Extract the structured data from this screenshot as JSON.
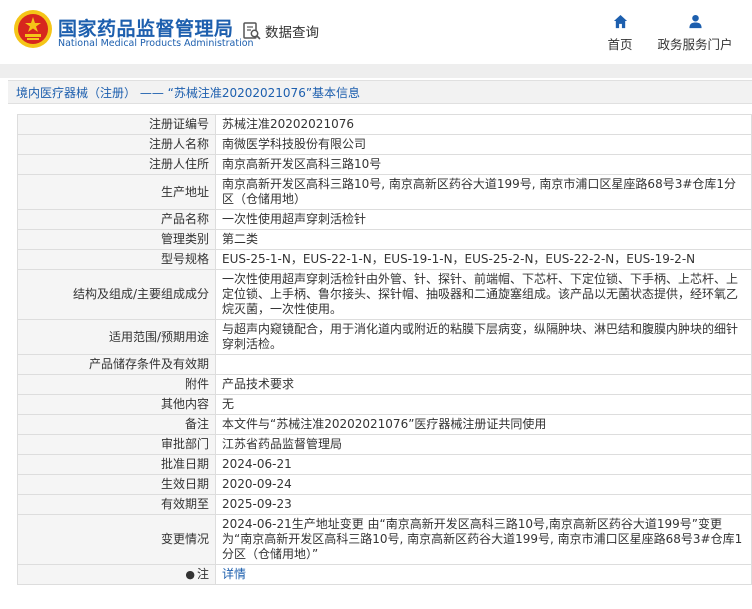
{
  "header": {
    "brand_cn": "国家药品监督管理局",
    "brand_en": "National Medical Products Administration",
    "search_label": "数据查询",
    "nav_home": "首页",
    "nav_portal": "政务服务门户"
  },
  "breadcrumb": "境内医疗器械（注册） —— “苏械注准20202021076”基本信息",
  "rows": [
    {
      "label": "注册证编号",
      "value": "苏械注准20202021076"
    },
    {
      "label": "注册人名称",
      "value": "南微医学科技股份有限公司"
    },
    {
      "label": "注册人住所",
      "value": "南京高新开发区高科三路10号"
    },
    {
      "label": "生产地址",
      "value": "南京高新开发区高科三路10号, 南京高新区药谷大道199号, 南京市浦口区星座路68号3#仓库1分区（仓储用地）"
    },
    {
      "label": "产品名称",
      "value": "一次性使用超声穿刺活检针"
    },
    {
      "label": "管理类别",
      "value": "第二类"
    },
    {
      "label": "型号规格",
      "value": "EUS-25-1-N，EUS-22-1-N，EUS-19-1-N，EUS-25-2-N，EUS-22-2-N，EUS-19-2-N"
    },
    {
      "label": "结构及组成/主要组成成分",
      "value": "一次性使用超声穿刺活检针由外管、针、探针、前端帽、下芯杆、下定位锁、下手柄、上芯杆、上定位锁、上手柄、鲁尔接头、探针帽、抽吸器和二通旋塞组成。该产品以无菌状态提供，经环氧乙烷灭菌，一次性使用。"
    },
    {
      "label": "适用范围/预期用途",
      "value": "与超声内窥镜配合，用于消化道内或附近的粘膜下层病变，纵隔肿块、淋巴结和腹膜内肿块的细针穿刺活检。"
    },
    {
      "label": "产品储存条件及有效期",
      "value": ""
    },
    {
      "label": "附件",
      "value": "产品技术要求"
    },
    {
      "label": "其他内容",
      "value": "无"
    },
    {
      "label": "备注",
      "value": "本文件与“苏械注准20202021076”医疗器械注册证共同使用"
    },
    {
      "label": "审批部门",
      "value": "江苏省药品监督管理局"
    },
    {
      "label": "批准日期",
      "value": "2024-06-21"
    },
    {
      "label": "生效日期",
      "value": "2020-09-24"
    },
    {
      "label": "有效期至",
      "value": "2025-09-23"
    },
    {
      "label": "变更情况",
      "value": "2024-06-21生产地址变更 由“南京高新开发区高科三路10号,南京高新区药谷大道199号”变更为“南京高新开发区高科三路10号, 南京高新区药谷大道199号, 南京市浦口区星座路68号3#仓库1分区（仓储用地）”"
    }
  ],
  "note_row": {
    "label": "注",
    "link": "详情"
  },
  "colors": {
    "brand_blue": "#1d5fae",
    "emblem_red": "#d7261e",
    "emblem_gold": "#f5c518"
  }
}
